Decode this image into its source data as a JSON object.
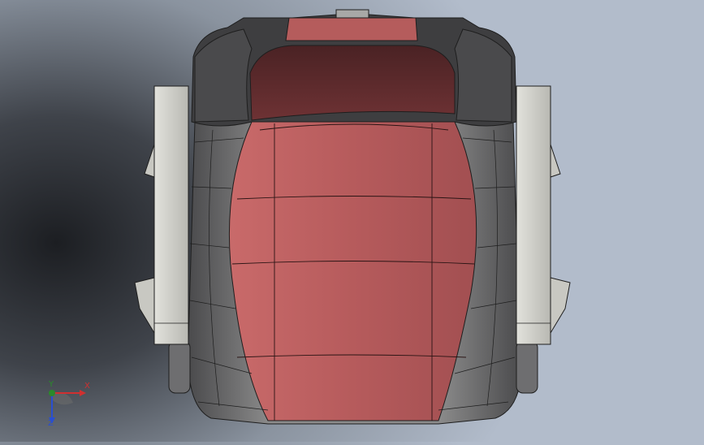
{
  "viewport": {
    "model": "seat-shell",
    "colors": {
      "cushion": "#b85a5a",
      "cushion_top": "#5e2a2c",
      "shell": "#7a7a7a",
      "shell_dark": "#3e3e40",
      "bracket": "#cfcfc8"
    }
  },
  "triad": {
    "x_label": "X",
    "y_label": "Y",
    "z_label": "Z",
    "colors": {
      "x": "#d03030",
      "y": "#2a8a2a",
      "z": "#2a4fd0"
    }
  }
}
